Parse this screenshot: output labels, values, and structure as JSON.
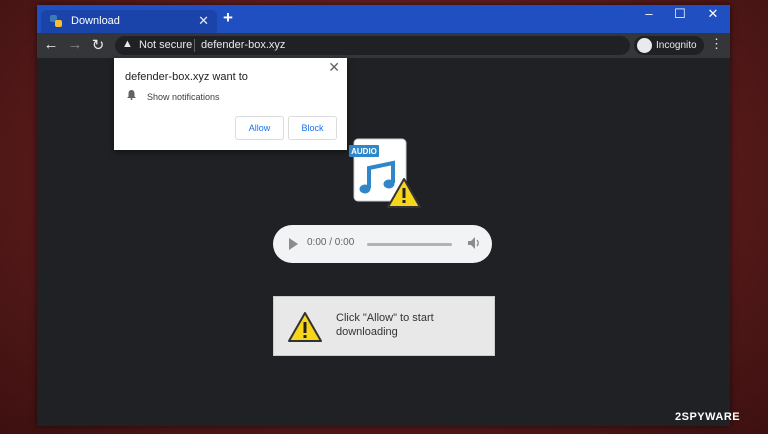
{
  "tab": {
    "title": "Download",
    "close": "✕",
    "new_tab": "+"
  },
  "window_controls": {
    "minimize": "–",
    "maximize": "☐",
    "close": "✕"
  },
  "nav": {
    "back": "←",
    "forward": "→",
    "reload": "↻"
  },
  "omnibox": {
    "security_label": "Not secure",
    "url": "defender-box.xyz"
  },
  "profile": {
    "label": "Incognito"
  },
  "menu": "⋮",
  "notification_prompt": {
    "title": "defender-box.xyz want to",
    "permission": "Show notifications",
    "allow": "Allow",
    "block": "Block",
    "close": "✕"
  },
  "audio_icon": {
    "badge": "AUDIO"
  },
  "player": {
    "time": "0:00 / 0:00"
  },
  "message": {
    "text": "Click \"Allow\" to start downloading"
  },
  "watermark": "2SPYWARE",
  "colors": {
    "titlebar": "#1f4fc1",
    "toolbar": "#35363a",
    "content": "#202124",
    "link_blue": "#1a73e8",
    "warning": "#f7d51a"
  }
}
